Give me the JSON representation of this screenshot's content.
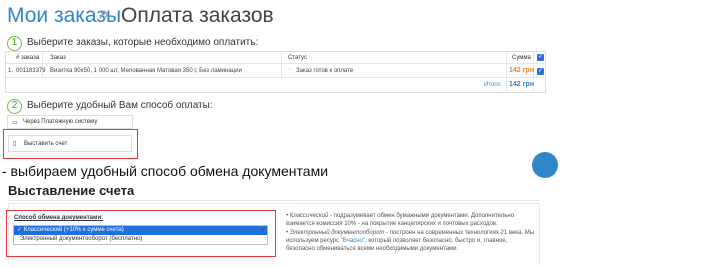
{
  "header": {
    "breadcrumb_link": "Мои заказы",
    "separator": "»",
    "title": "Оплата заказов"
  },
  "step1": {
    "number": "1",
    "text": "Выберите заказы, которые необходимо оплатить:"
  },
  "table": {
    "columns": [
      "# заказа",
      "Заказ",
      "Статус",
      "Сумма"
    ],
    "rows": [
      {
        "index": "1.",
        "order_number": "001183379",
        "order": "Визитка 90х50, 1 000 шт, Мелованная Матовая 350 г, Без ламинации",
        "status": "Заказ готов к оплате",
        "sum": "142 грн"
      }
    ],
    "total_label": "Итого:",
    "total_value": "142 грн"
  },
  "step2": {
    "number": "2",
    "text": "Выберите удобный Вам способ оплаты:"
  },
  "payment_options": {
    "option1": "Через Платежную систему",
    "option2": "Выставить счет"
  },
  "caption": "- выбираем удобный способ обмена документами",
  "invoice_panel": {
    "title": "Выставление счета",
    "field_label": "Способ обмена документами:",
    "options": [
      "Классический (+10% к сумме счета)",
      "Электронный документооборот (бесплатно)"
    ],
    "desc1_italic": "Классический",
    "desc1_text": " - подразумевает обмен бумажными документами. Дополнительно взимается комиссия 10% - на покрытие канцелярских и почтовых расходов.",
    "desc2_italic": "Электронный документооборот",
    "desc2_text": " - построен на современных технологиях 21 века. Мы используем ресурс ",
    "desc2_link": "\"Вчасно\"",
    "desc2_end": ", который позволяет безопасно, быстро и, главное, безопасно обмениваться всеми необходимыми документами."
  },
  "colors": {
    "accent_blue": "#2f86c9",
    "price_orange": "#f0821e",
    "step_green": "#6fbf3b",
    "highlight_red": "#e03a3a",
    "select_blue": "#1f6fe0"
  }
}
